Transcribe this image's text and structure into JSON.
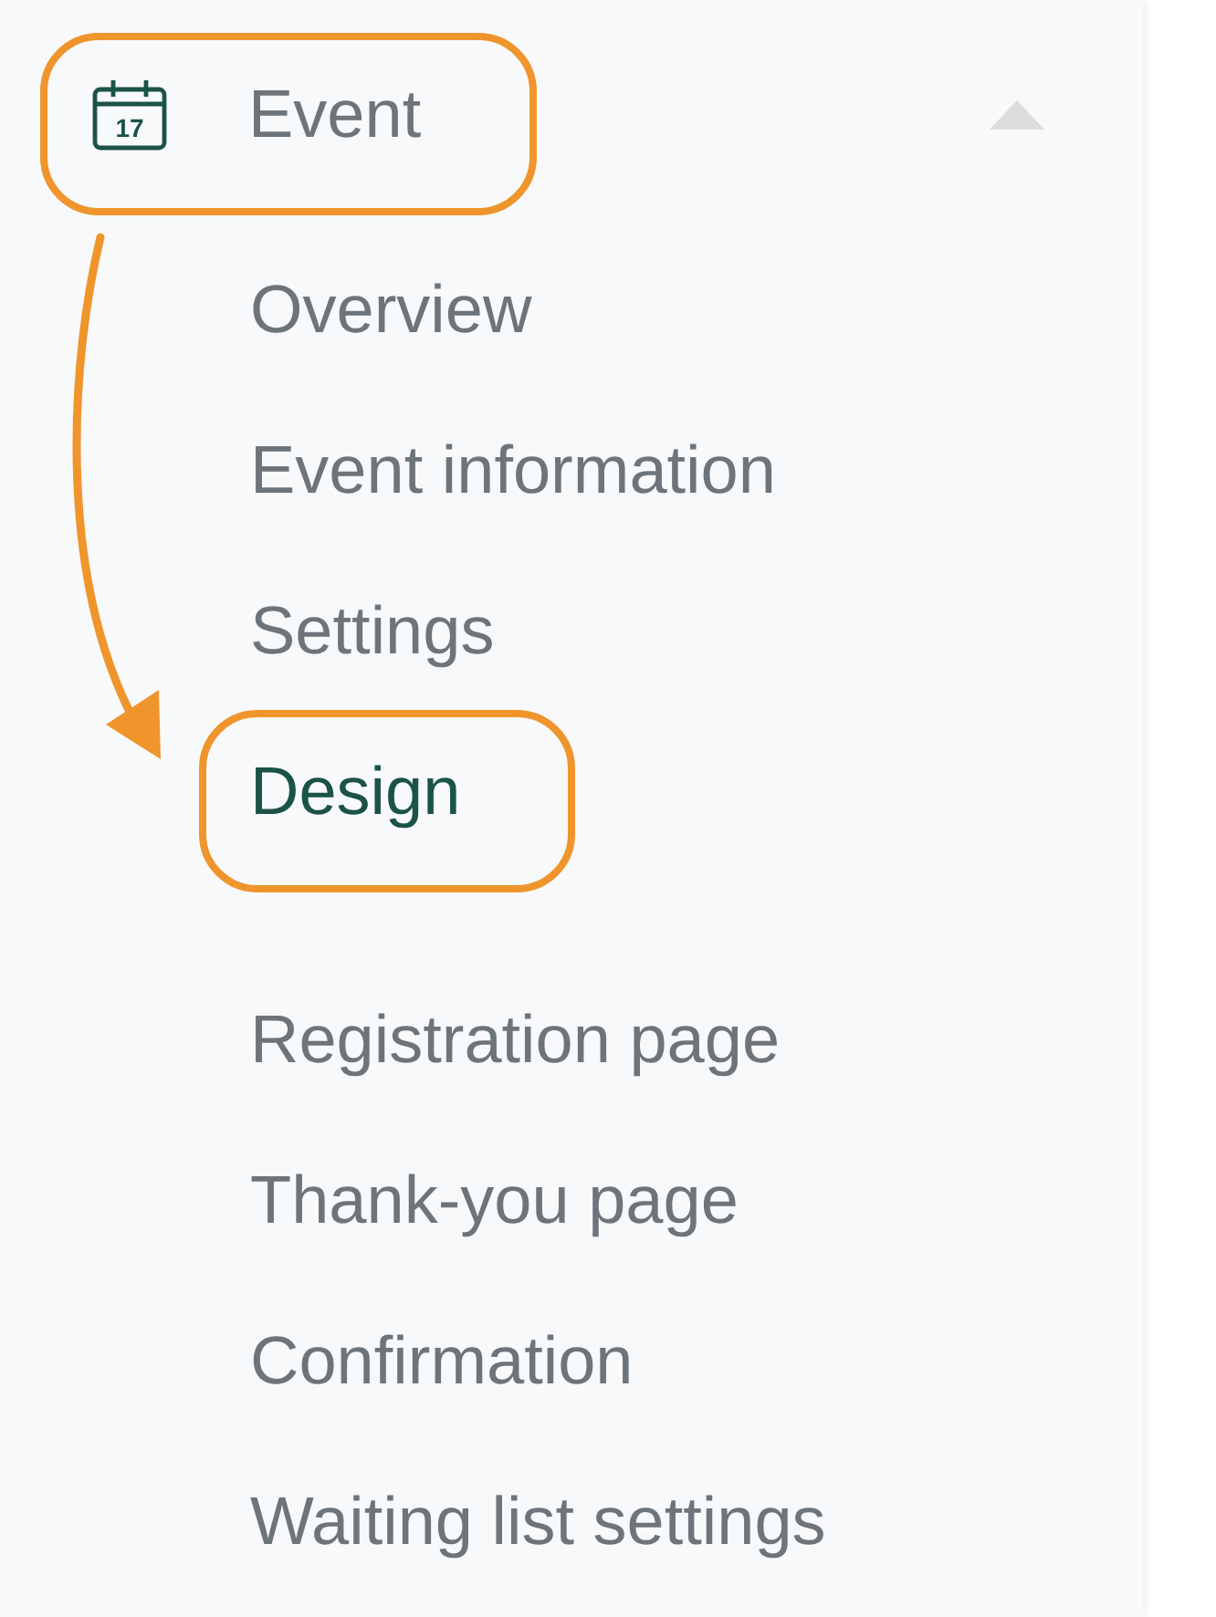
{
  "menu": {
    "label": "Event",
    "icon_date": "17",
    "expanded": true,
    "highlighted": true,
    "groups": [
      {
        "items": [
          {
            "label": "Overview",
            "selected": false,
            "highlighted": false
          },
          {
            "label": "Event information",
            "selected": false,
            "highlighted": false
          },
          {
            "label": "Settings",
            "selected": false,
            "highlighted": false
          },
          {
            "label": "Design",
            "selected": true,
            "highlighted": true
          }
        ]
      },
      {
        "items": [
          {
            "label": "Registration page",
            "selected": false,
            "highlighted": false
          },
          {
            "label": "Thank-you page",
            "selected": false,
            "highlighted": false
          },
          {
            "label": "Confirmation",
            "selected": false,
            "highlighted": false
          },
          {
            "label": "Waiting list settings",
            "selected": false,
            "highlighted": false
          }
        ]
      }
    ]
  }
}
